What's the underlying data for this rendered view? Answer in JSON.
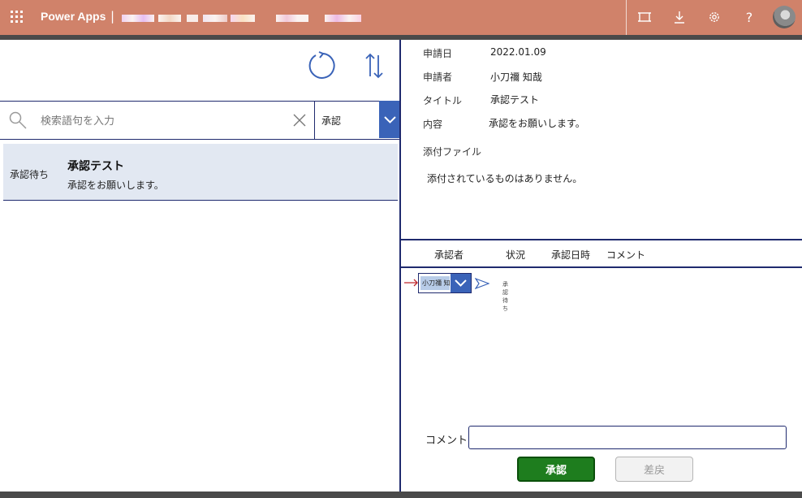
{
  "header": {
    "app_name": "Power Apps",
    "separator": "|",
    "bg_color": "#d0826a"
  },
  "toolbar": {
    "refresh_icon": "refresh-icon",
    "sort_icon": "sort-icon"
  },
  "search": {
    "placeholder": "検索語句を入力",
    "value": "",
    "filter_selected": "承認"
  },
  "list": {
    "items": [
      {
        "status": "承認待ち",
        "title": "承認テスト",
        "body": "承認をお願いします。"
      }
    ]
  },
  "detail": {
    "apply_date_label": "申請日",
    "apply_date": "2022.01.09",
    "applicant_label": "申請者",
    "applicant": "小刀禰 知哉",
    "title_label": "タイトル",
    "title": "承認テスト",
    "content_label": "内容",
    "content": "承認をお願いします。",
    "attachments_label": "添付ファイル",
    "attachments_empty": "添付されているものはありません。"
  },
  "approval_table": {
    "columns": [
      "承認者",
      "状況",
      "承認日時",
      "コメント"
    ],
    "rows": [
      {
        "approver": "小刀禰 知哉",
        "status": "承認待ち"
      }
    ]
  },
  "actions": {
    "comment_label": "コメント",
    "comment_value": "",
    "approve_label": "承認",
    "reject_label": "差戻",
    "approve_color": "#1e7d1e"
  }
}
